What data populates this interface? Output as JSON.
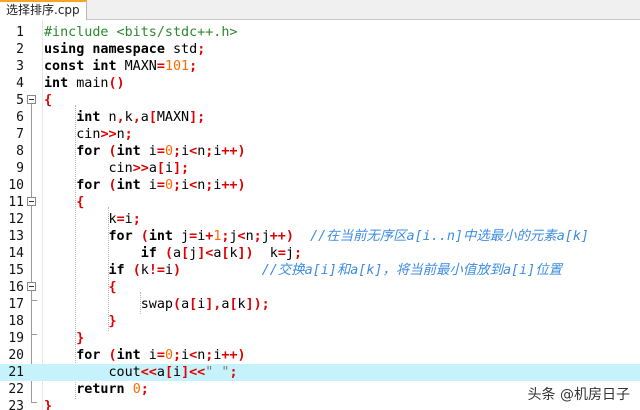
{
  "tab": {
    "label": "选择排序.cpp"
  },
  "line_numbers": [
    "1",
    "2",
    "3",
    "4",
    "5",
    "6",
    "7",
    "8",
    "9",
    "10",
    "11",
    "12",
    "13",
    "14",
    "15",
    "16",
    "17",
    "18",
    "19",
    "20",
    "21",
    "22",
    "23"
  ],
  "lines": [
    [
      {
        "t": "#include <bits/stdc++.h>",
        "c": "pp"
      }
    ],
    [
      {
        "t": "using",
        "c": "kw"
      },
      {
        "t": " "
      },
      {
        "t": "namespace",
        "c": "kw"
      },
      {
        "t": " std"
      },
      {
        "t": ";",
        "c": "op"
      }
    ],
    [
      {
        "t": "const",
        "c": "kw"
      },
      {
        "t": " "
      },
      {
        "t": "int",
        "c": "kw"
      },
      {
        "t": " MAXN"
      },
      {
        "t": "=",
        "c": "op"
      },
      {
        "t": "101",
        "c": "num"
      },
      {
        "t": ";",
        "c": "op"
      }
    ],
    [
      {
        "t": "int",
        "c": "kw"
      },
      {
        "t": " main"
      },
      {
        "t": "()",
        "c": "op"
      }
    ],
    [
      {
        "t": "{",
        "c": "op"
      }
    ],
    [
      {
        "t": "    "
      },
      {
        "t": "int",
        "c": "kw"
      },
      {
        "t": " n"
      },
      {
        "t": ",",
        "c": "op"
      },
      {
        "t": "k"
      },
      {
        "t": ",",
        "c": "op"
      },
      {
        "t": "a"
      },
      {
        "t": "[",
        "c": "op"
      },
      {
        "t": "MAXN"
      },
      {
        "t": "];",
        "c": "op"
      }
    ],
    [
      {
        "t": "    cin"
      },
      {
        "t": ">>",
        "c": "op"
      },
      {
        "t": "n"
      },
      {
        "t": ";",
        "c": "op"
      }
    ],
    [
      {
        "t": "    "
      },
      {
        "t": "for",
        "c": "kw"
      },
      {
        "t": " "
      },
      {
        "t": "(",
        "c": "op"
      },
      {
        "t": "int",
        "c": "kw"
      },
      {
        "t": " i"
      },
      {
        "t": "=",
        "c": "op"
      },
      {
        "t": "0",
        "c": "num"
      },
      {
        "t": ";",
        "c": "op"
      },
      {
        "t": "i"
      },
      {
        "t": "<",
        "c": "op"
      },
      {
        "t": "n"
      },
      {
        "t": ";",
        "c": "op"
      },
      {
        "t": "i"
      },
      {
        "t": "++)",
        "c": "op"
      }
    ],
    [
      {
        "t": "        cin"
      },
      {
        "t": ">>",
        "c": "op"
      },
      {
        "t": "a"
      },
      {
        "t": "[",
        "c": "op"
      },
      {
        "t": "i"
      },
      {
        "t": "];",
        "c": "op"
      }
    ],
    [
      {
        "t": "    "
      },
      {
        "t": "for",
        "c": "kw"
      },
      {
        "t": " "
      },
      {
        "t": "(",
        "c": "op"
      },
      {
        "t": "int",
        "c": "kw"
      },
      {
        "t": " i"
      },
      {
        "t": "=",
        "c": "op"
      },
      {
        "t": "0",
        "c": "num"
      },
      {
        "t": ";",
        "c": "op"
      },
      {
        "t": "i"
      },
      {
        "t": "<",
        "c": "op"
      },
      {
        "t": "n"
      },
      {
        "t": ";",
        "c": "op"
      },
      {
        "t": "i"
      },
      {
        "t": "++)",
        "c": "op"
      }
    ],
    [
      {
        "t": "    "
      },
      {
        "t": "{",
        "c": "op"
      }
    ],
    [
      {
        "t": "        k"
      },
      {
        "t": "=",
        "c": "op"
      },
      {
        "t": "i"
      },
      {
        "t": ";",
        "c": "op"
      }
    ],
    [
      {
        "t": "        "
      },
      {
        "t": "for",
        "c": "kw"
      },
      {
        "t": " "
      },
      {
        "t": "(",
        "c": "op"
      },
      {
        "t": "int",
        "c": "kw"
      },
      {
        "t": " j"
      },
      {
        "t": "=",
        "c": "op"
      },
      {
        "t": "i"
      },
      {
        "t": "+",
        "c": "op"
      },
      {
        "t": "1",
        "c": "num"
      },
      {
        "t": ";",
        "c": "op"
      },
      {
        "t": "j"
      },
      {
        "t": "<",
        "c": "op"
      },
      {
        "t": "n"
      },
      {
        "t": ";",
        "c": "op"
      },
      {
        "t": "j"
      },
      {
        "t": "++)",
        "c": "op"
      },
      {
        "t": "  "
      },
      {
        "t": "//在当前无序区a[i..n]中选最小的元素a[k]",
        "c": "cm"
      }
    ],
    [
      {
        "t": "            "
      },
      {
        "t": "if",
        "c": "kw"
      },
      {
        "t": " "
      },
      {
        "t": "(",
        "c": "op"
      },
      {
        "t": "a"
      },
      {
        "t": "[",
        "c": "op"
      },
      {
        "t": "j"
      },
      {
        "t": "]<",
        "c": "op"
      },
      {
        "t": "a"
      },
      {
        "t": "[",
        "c": "op"
      },
      {
        "t": "k"
      },
      {
        "t": "])",
        "c": "op"
      },
      {
        "t": "  k"
      },
      {
        "t": "=",
        "c": "op"
      },
      {
        "t": "j"
      },
      {
        "t": ";",
        "c": "op"
      }
    ],
    [
      {
        "t": "        "
      },
      {
        "t": "if",
        "c": "kw"
      },
      {
        "t": " "
      },
      {
        "t": "(",
        "c": "op"
      },
      {
        "t": "k"
      },
      {
        "t": "!=",
        "c": "op"
      },
      {
        "t": "i"
      },
      {
        "t": ")",
        "c": "op"
      },
      {
        "t": "          "
      },
      {
        "t": "//交换a[i]和a[k]，将当前最小值放到a[i]位置",
        "c": "cm"
      }
    ],
    [
      {
        "t": "        "
      },
      {
        "t": "{",
        "c": "op"
      }
    ],
    [
      {
        "t": "            swap"
      },
      {
        "t": "(",
        "c": "op"
      },
      {
        "t": "a"
      },
      {
        "t": "[",
        "c": "op"
      },
      {
        "t": "i"
      },
      {
        "t": "],",
        "c": "op"
      },
      {
        "t": "a"
      },
      {
        "t": "[",
        "c": "op"
      },
      {
        "t": "k"
      },
      {
        "t": "]);",
        "c": "op"
      }
    ],
    [
      {
        "t": "        "
      },
      {
        "t": "}",
        "c": "op"
      }
    ],
    [
      {
        "t": "    "
      },
      {
        "t": "}",
        "c": "op"
      }
    ],
    [
      {
        "t": "    "
      },
      {
        "t": "for",
        "c": "kw"
      },
      {
        "t": " "
      },
      {
        "t": "(",
        "c": "op"
      },
      {
        "t": "int",
        "c": "kw"
      },
      {
        "t": " i"
      },
      {
        "t": "=",
        "c": "op"
      },
      {
        "t": "0",
        "c": "num"
      },
      {
        "t": ";",
        "c": "op"
      },
      {
        "t": "i"
      },
      {
        "t": "<",
        "c": "op"
      },
      {
        "t": "n"
      },
      {
        "t": ";",
        "c": "op"
      },
      {
        "t": "i"
      },
      {
        "t": "++)",
        "c": "op"
      }
    ],
    [
      {
        "t": "        cout"
      },
      {
        "t": "<<",
        "c": "op"
      },
      {
        "t": "a"
      },
      {
        "t": "[",
        "c": "op"
      },
      {
        "t": "i"
      },
      {
        "t": "]<<",
        "c": "op"
      },
      {
        "t": "\" \"",
        "c": "str"
      },
      {
        "t": ";",
        "c": "op"
      }
    ],
    [
      {
        "t": "    "
      },
      {
        "t": "return",
        "c": "kw"
      },
      {
        "t": " "
      },
      {
        "t": "0",
        "c": "num"
      },
      {
        "t": ";",
        "c": "op"
      }
    ],
    [
      {
        "t": "}",
        "c": "op"
      }
    ]
  ],
  "current_line": 21,
  "fold_lines": [
    5,
    11,
    16
  ],
  "watermark": "头条 @机房日子",
  "colors": {
    "keyword": "#000000",
    "preprocessor": "#2b8a2b",
    "number": "#ff6a00",
    "operator": "#e00000",
    "comment": "#3c8ce0",
    "current_line_bg": "#c6f2fb"
  }
}
